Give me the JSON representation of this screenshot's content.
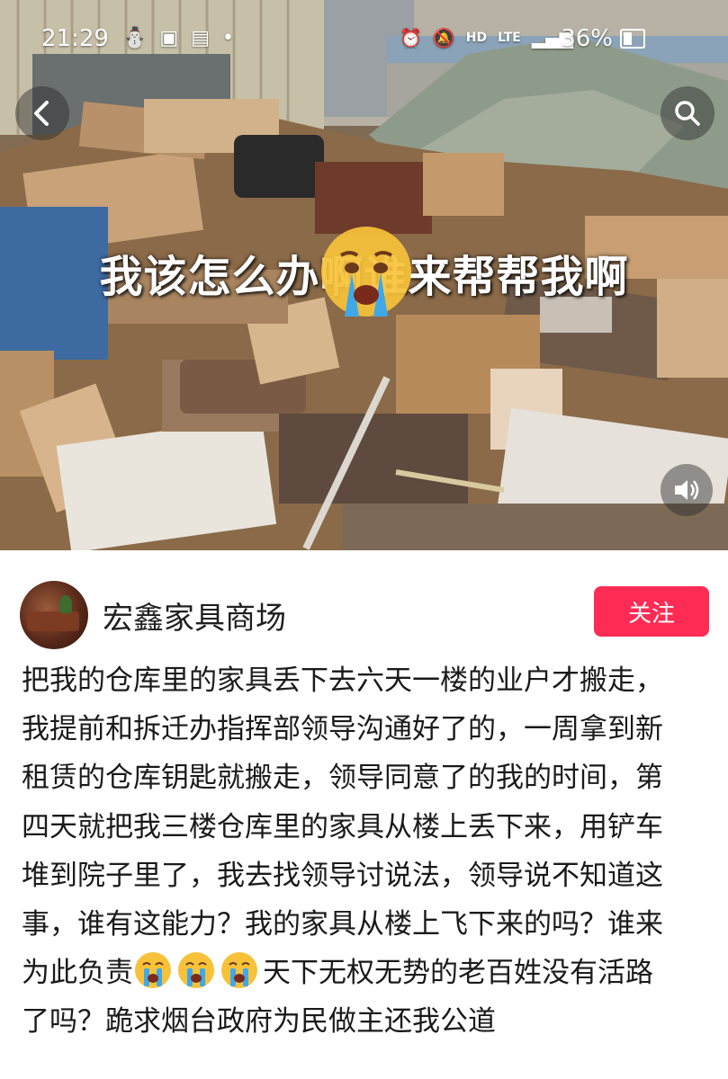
{
  "status_bar": {
    "time": "21:29",
    "network": "HD",
    "lte": "LTE",
    "battery": "36%",
    "icons": [
      "alarm-icon",
      "mute-icon",
      "signal-icon",
      "battery-icon"
    ]
  },
  "media": {
    "overlay_text": "我该怎么办啊谁来帮帮我啊",
    "overlay_emoji": "crying-face-emoji",
    "buttons": {
      "back": "back-arrow-icon",
      "search": "search-icon",
      "sound": "speaker-icon"
    }
  },
  "author": {
    "name": "宏鑫家具商场",
    "follow_label": "关注"
  },
  "post": {
    "lines": [
      "把我的仓库里的家具丢下去六天一楼的业户才搬走，",
      "我提前和拆迁办指挥部领导沟通好了的，一周拿到新",
      "租赁的仓库钥匙就搬走，领导同意了的我的时间，第",
      "四天就把我三楼仓库里的家具从楼上丢下来，用铲车",
      "堆到院子里了，我去找领导讨说法，领导说不知道这",
      "事，谁有这能力？我的家具从楼上飞下来的吗？谁来"
    ],
    "line7_before": "为此负责",
    "line7_after": "天下无权无势的老百姓没有活路",
    "line8": "了吗？跪求烟台政府为民做主还我公道",
    "inline_emoji_count": 3
  },
  "colors": {
    "follow_button": "#fe2c55",
    "text": "#1a1a1a",
    "overlay_text": "#ffffff"
  }
}
